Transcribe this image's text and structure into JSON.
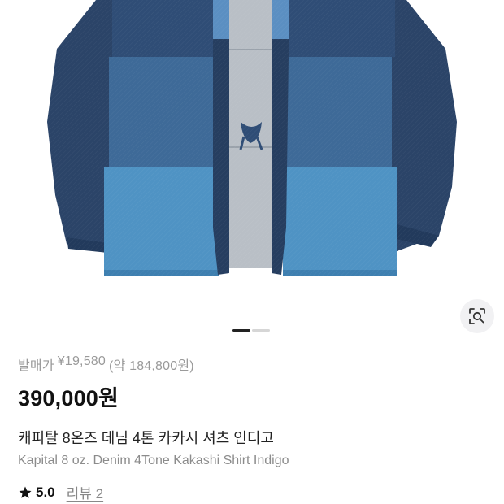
{
  "product": {
    "original_price_label": "발매가",
    "original_price_yen": "¥19,580",
    "original_price_krw": "(약 184,800원)",
    "price": "390,000원",
    "name_ko": "캐피탈 8온즈 데님 4톤 카카시 셔츠 인디고",
    "name_en": "Kapital 8 oz. Denim 4Tone Kakashi Shirt Indigo",
    "rating": "5.0",
    "reviews_label": "리뷰 2"
  },
  "gallery": {
    "current_page": 1,
    "total_pages": 2
  },
  "icons": {
    "lens": "lens-search-icon",
    "star": "star-icon"
  },
  "colors": {
    "denim_dark": "#2b4468",
    "denim_mid": "#3f6c9a",
    "denim_light": "#4f93c4",
    "lining": "#b9bfc6",
    "star": "#111111"
  }
}
